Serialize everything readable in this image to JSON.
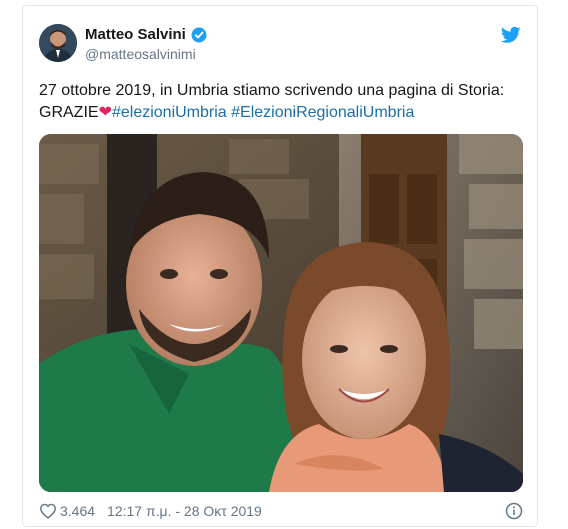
{
  "tweet": {
    "display_name": "Matteo Salvini",
    "handle": "@matteosalvinimi",
    "text_line1": "27 ottobre 2019, in Umbria stiamo scrivendo una pagina di Storia:",
    "text_grazie": "GRAZIE",
    "heart": "❤",
    "hashtag1": "#elezioniUmbria",
    "hashtag2": "#ElezioniRegionaliUmbria",
    "likes": "3.464",
    "timestamp": "12:17 π.μ. - 28 Οκτ 2019"
  },
  "colors": {
    "link": "#1b6fa8",
    "twitter_blue": "#1da1f2",
    "heart": "#e0245e",
    "muted": "#657786"
  },
  "icons": [
    "verified-icon",
    "twitter-bird-icon",
    "heart-icon",
    "info-icon"
  ]
}
